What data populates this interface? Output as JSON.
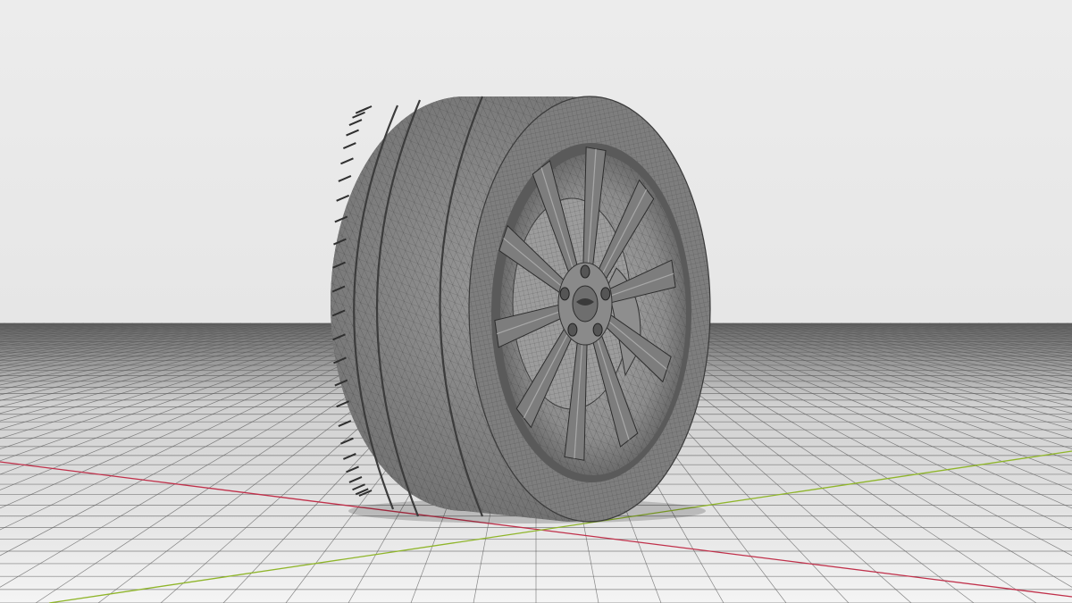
{
  "viewport": {
    "colors": {
      "background": "#e6e6e6",
      "floor": "#f2f2f2",
      "horizon_band": "#6e6e6e",
      "grid_line": "#5a5a5a",
      "axis_x": "#c0304a",
      "axis_y": "#8fb52a",
      "mesh_body": "#8a8a8a",
      "mesh_wire": "#3a3a3a",
      "rim": "#7d7d7d"
    },
    "objects": [
      {
        "name": "tire",
        "icon": "wheel-mesh"
      },
      {
        "name": "wheel",
        "icon": "spoke-rim"
      },
      {
        "name": "brake-disc",
        "icon": "disc"
      }
    ],
    "wheel": {
      "spokes": 10,
      "lug_nuts": 5
    }
  }
}
